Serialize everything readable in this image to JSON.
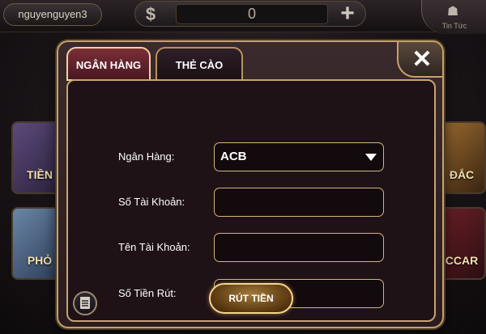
{
  "top_bar": {
    "username": "nguyenguyen3",
    "balance": "0",
    "news_label": "Tin Tức"
  },
  "background_tiles": {
    "left_1": "TIỀN",
    "left_2": "PHỎ",
    "right_1": "ĐẮC",
    "right_2": "CCAR"
  },
  "modal": {
    "tabs": [
      {
        "label": "NGÂN HÀNG",
        "active": true
      },
      {
        "label": "THẺ CÀO",
        "active": false
      }
    ],
    "close_symbol": "✕",
    "form": {
      "bank_label": "Ngân Hàng:",
      "bank_value": "ACB",
      "account_number_label": "Số Tài Khoản:",
      "account_number_value": "",
      "account_name_label": "Tên Tài Khoản:",
      "account_name_value": "",
      "amount_label": "Số Tiền Rút:",
      "amount_value": ""
    },
    "submit_label": "RÚT TIỀN"
  },
  "colors": {
    "accent_gold": "#c6a269",
    "active_tab": "#7a2e38",
    "panel_bg": "#1e1216"
  },
  "icons": [
    "coin-icon",
    "plus-icon",
    "news-icon",
    "close-icon",
    "caret-down-icon",
    "doc-icon"
  ]
}
